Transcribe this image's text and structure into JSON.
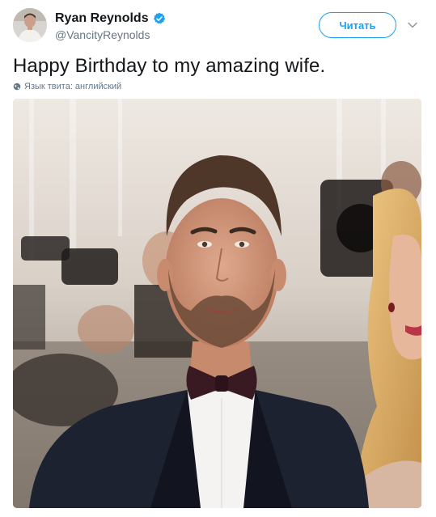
{
  "author": {
    "display_name": "Ryan Reynolds",
    "handle": "@VancityReynolds",
    "verified": true,
    "avatar_icon": "profile-photo"
  },
  "follow_button": {
    "label": "Читать"
  },
  "menu": {
    "icon": "chevron-down-icon"
  },
  "tweet": {
    "text": "Happy Birthday to my amazing wife.",
    "language_note": "Язык твита: английский",
    "language_icon": "globe-icon"
  },
  "media": {
    "kind": "photo"
  },
  "colors": {
    "accent": "#1da1f2",
    "secondary_text": "#657786",
    "primary_text": "#14171a"
  }
}
